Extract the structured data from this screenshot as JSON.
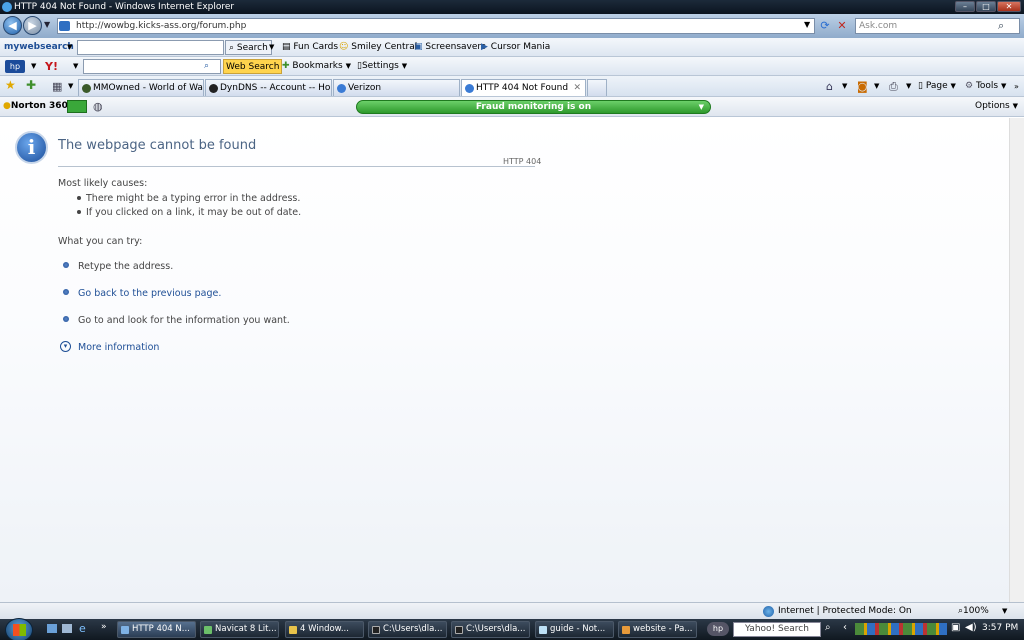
{
  "window": {
    "title": "HTTP 404 Not Found - Windows Internet Explorer",
    "min": "–",
    "max": "□",
    "close": "✕"
  },
  "address": {
    "url": "http://wowbg.kicks-ass.org/forum.php",
    "search_placeholder": "Ask.com"
  },
  "toolbar1": {
    "brand": "mywebsearch",
    "search_label": "Search",
    "items": [
      "Fun Cards",
      "Smiley Central",
      "Screensavers",
      "Cursor Mania"
    ]
  },
  "toolbar2": {
    "web_search": "Web Search",
    "bookmarks": "Bookmarks",
    "settings": "Settings"
  },
  "tabs": [
    {
      "label": "MMOwned - World of War..."
    },
    {
      "label": "DynDNS -- Account -- Ho..."
    },
    {
      "label": "Verizon"
    },
    {
      "label": "HTTP 404 Not Found"
    }
  ],
  "tab_close": "✕",
  "command": {
    "page": "Page",
    "tools": "Tools"
  },
  "norton": {
    "label": "Norton 360",
    "fraud": "Fraud monitoring is on",
    "options": "Options"
  },
  "page": {
    "title": "The webpage cannot be found",
    "code": "HTTP 404",
    "causes_heading": "Most likely causes:",
    "causes": [
      "There might be a typing error in the address.",
      "If you clicked on a link, it may be out of date."
    ],
    "try_heading": "What you can try:",
    "tries": [
      "Retype the address.",
      "Go back to the previous page.",
      "Go to  and look for the information you want."
    ],
    "more": "More information"
  },
  "status": {
    "zone": "Internet | Protected Mode: On",
    "zoom": "100%"
  },
  "taskbar": {
    "tasks": [
      "HTTP 404 N...",
      "Navicat 8 Lit...",
      "4 Window...",
      "C:\\Users\\dla...",
      "C:\\Users\\dla...",
      "guide - Not...",
      "website - Pa..."
    ],
    "search": "Yahoo! Search",
    "time": "3:57 PM"
  },
  "colors": {
    "title": "#4b6484",
    "link": "#1f4f96",
    "fraud": "#2e9a2c"
  }
}
